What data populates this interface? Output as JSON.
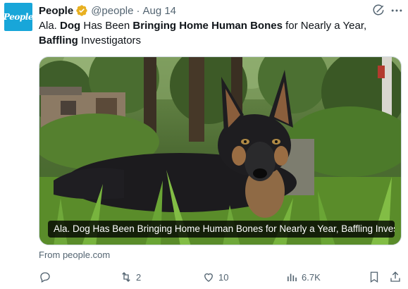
{
  "tweet": {
    "author_logo_text": "People",
    "author_name": "People",
    "handle": "@people",
    "separator": "·",
    "date": "Aug 14",
    "text_parts": [
      {
        "t": "Ala. ",
        "b": false
      },
      {
        "t": "Dog",
        "b": true
      },
      {
        "t": " Has Been ",
        "b": false
      },
      {
        "t": "Bringing Home Human Bones",
        "b": true
      },
      {
        "t": " for Nearly a Year, ",
        "b": false
      },
      {
        "t": "Baffling",
        "b": true
      },
      {
        "t": " Investigators",
        "b": false
      }
    ],
    "media_caption": "Ala. Dog Has Been Bringing Home Human Bones for Nearly a Year, Baffling Invest...",
    "source": "From people.com"
  },
  "actions": {
    "reply_count": "",
    "retweet_count": "2",
    "like_count": "10",
    "views_count": "6.7K"
  },
  "colors": {
    "brand": "#18a6d9",
    "verified": "#e8b021",
    "muted": "#536471"
  },
  "icons": [
    "grok-icon",
    "more-icon",
    "reply-icon",
    "retweet-icon",
    "like-icon",
    "views-icon",
    "bookmark-icon",
    "share-icon",
    "verified-badge-icon"
  ]
}
